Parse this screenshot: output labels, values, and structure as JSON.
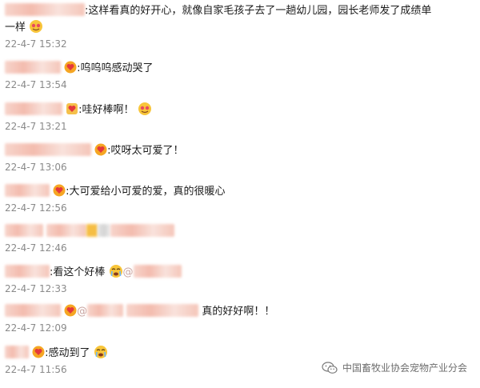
{
  "comments": [
    {
      "text_a": ":这样看真的好开心，就像自家毛孩子去了一趟幼儿园，园长老师发了成绩单",
      "text_b": "一样",
      "time": "22-4-7 15:32"
    },
    {
      "text": ":呜呜呜感动哭了",
      "time": "22-4-7 13:54"
    },
    {
      "text": ":哇好棒啊！",
      "time": "22-4-7 13:21"
    },
    {
      "text": ":哎呀太可爱了！",
      "time": "22-4-7 13:06"
    },
    {
      "text": ":大可爱给小可爱的爱，真的很暖心",
      "time": "22-4-7 12:56"
    },
    {
      "text": "",
      "time": "22-4-7 12:46"
    },
    {
      "text": ":看这个好棒",
      "mention": "@",
      "time": "22-4-7 12:33"
    },
    {
      "mention": "@",
      "text": "真的好好啊！！",
      "time": "22-4-7 12:09"
    },
    {
      "text": ":感动到了",
      "time": "22-4-7 11:56"
    }
  ],
  "watermark": {
    "text": "中国畜牧业协会宠物产业分会",
    "icon": "wechat-icon"
  },
  "colors": {
    "blur": "#f2b5a6",
    "time": "#8a8a8a",
    "badge": "#f5a623"
  }
}
